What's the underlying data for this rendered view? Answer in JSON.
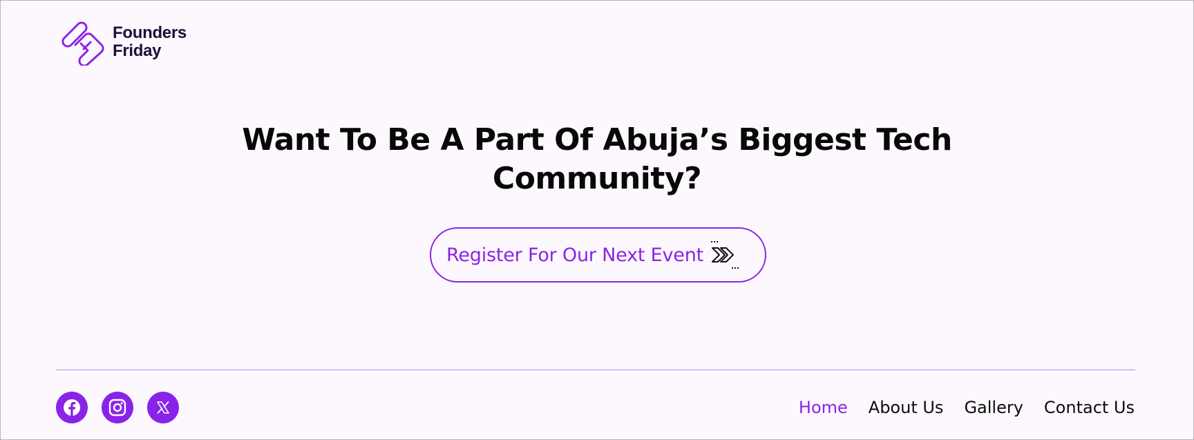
{
  "brand": {
    "name_line1": "Founders",
    "name_line2": "Friday",
    "logo_icon": "founders-friday-logo-mark",
    "accent_color": "#8a23e8"
  },
  "hero": {
    "title": "Want To Be A Part Of Abuja’s Biggest Tech Community?",
    "cta_label": "Register For Our Next Event",
    "cta_icon": "double-chevron-right-icon"
  },
  "footer": {
    "socials": [
      {
        "name": "Facebook",
        "icon": "facebook-icon"
      },
      {
        "name": "Instagram",
        "icon": "instagram-icon"
      },
      {
        "name": "X",
        "icon": "x-icon"
      }
    ],
    "nav": [
      {
        "label": "Home",
        "active": true
      },
      {
        "label": "About Us",
        "active": false
      },
      {
        "label": "Gallery",
        "active": false
      },
      {
        "label": "Contact Us",
        "active": false
      }
    ]
  }
}
